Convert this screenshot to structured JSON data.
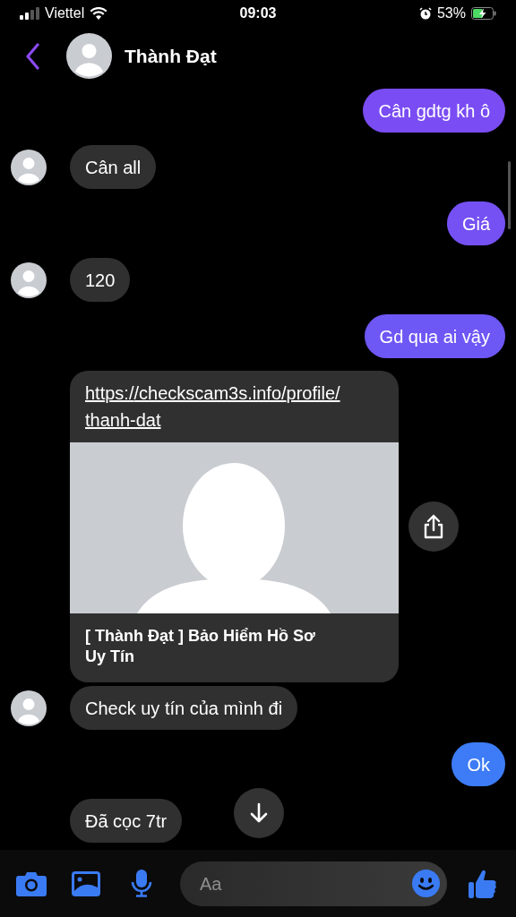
{
  "status_bar": {
    "carrier": "Viettel",
    "time": "09:03",
    "battery": "53%"
  },
  "header": {
    "title": "Thành Đạt"
  },
  "messages": [
    {
      "kind": "text",
      "outgoing": true,
      "text": "Cân gdtg kh ô",
      "color": "#7a4cf3"
    },
    {
      "kind": "text",
      "outgoing": false,
      "text": "Cân all",
      "avatar": true
    },
    {
      "kind": "text",
      "outgoing": true,
      "text": "Giá",
      "color": "#7551f4"
    },
    {
      "kind": "text",
      "outgoing": false,
      "text": "120",
      "avatar": true
    },
    {
      "kind": "text",
      "outgoing": true,
      "text": "Gd qua ai vậy",
      "color": "#6d57f5"
    },
    {
      "kind": "link",
      "outgoing": false,
      "url": "https://checkscam3s.info/profile/thanh-dat",
      "title": "[ Thành Đạt ] Bảo Hiểm Hồ Sơ Uy Tín",
      "avatar": false
    },
    {
      "kind": "text",
      "outgoing": false,
      "text": "Check uy tín của mình đi",
      "avatar": true
    },
    {
      "kind": "text",
      "outgoing": true,
      "text": "Ok",
      "color": "#3d7cf6"
    },
    {
      "kind": "text",
      "outgoing": false,
      "text": "Đã cọc 7tr",
      "avatar": false
    }
  ],
  "composer": {
    "placeholder": "Aa"
  }
}
